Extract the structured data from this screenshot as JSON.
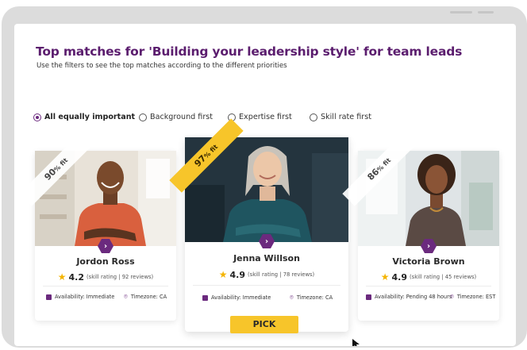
{
  "header": {
    "title": "Top matches for 'Building your leadership style' for team leads",
    "subtitle": "Use the filters to see the top matches according to the different priorities"
  },
  "filters": [
    {
      "label": "All equally important",
      "selected": true
    },
    {
      "label": "Background first",
      "selected": false
    },
    {
      "label": "Expertise first",
      "selected": false
    },
    {
      "label": "Skill rate first",
      "selected": false
    }
  ],
  "cards": [
    {
      "fit_value": "90",
      "fit_suffix": "% fit",
      "name": "Jordon Ross",
      "rating": "4.2",
      "rating_meta": "(skill rating | 92 reviews)",
      "availability": "Availability: Immediate",
      "timezone": "Timezone: CA"
    },
    {
      "fit_value": "97",
      "fit_suffix": "% fit",
      "name": "Jenna Willson",
      "rating": "4.9",
      "rating_meta": "(skill rating | 78 reviews)",
      "availability": "Availability: Immediate",
      "timezone": "Timezone: CA"
    },
    {
      "fit_value": "86",
      "fit_suffix": "% fit",
      "name": "Victoria Brown",
      "rating": "4.9",
      "rating_meta": "(skill rating | 45 reviews)",
      "availability": "Availability: Pending 48 hours",
      "timezone": "Timezone: EST"
    }
  ],
  "actions": {
    "pick_label": "PICK"
  },
  "icons": {
    "star": "star-icon",
    "calendar": "calendar-icon",
    "location": "location-pin-icon",
    "chevron": "chevron-right-icon"
  },
  "colors": {
    "brand_purple": "#5b1d6e",
    "accent_yellow": "#f7c52a",
    "star": "#f4b400"
  }
}
